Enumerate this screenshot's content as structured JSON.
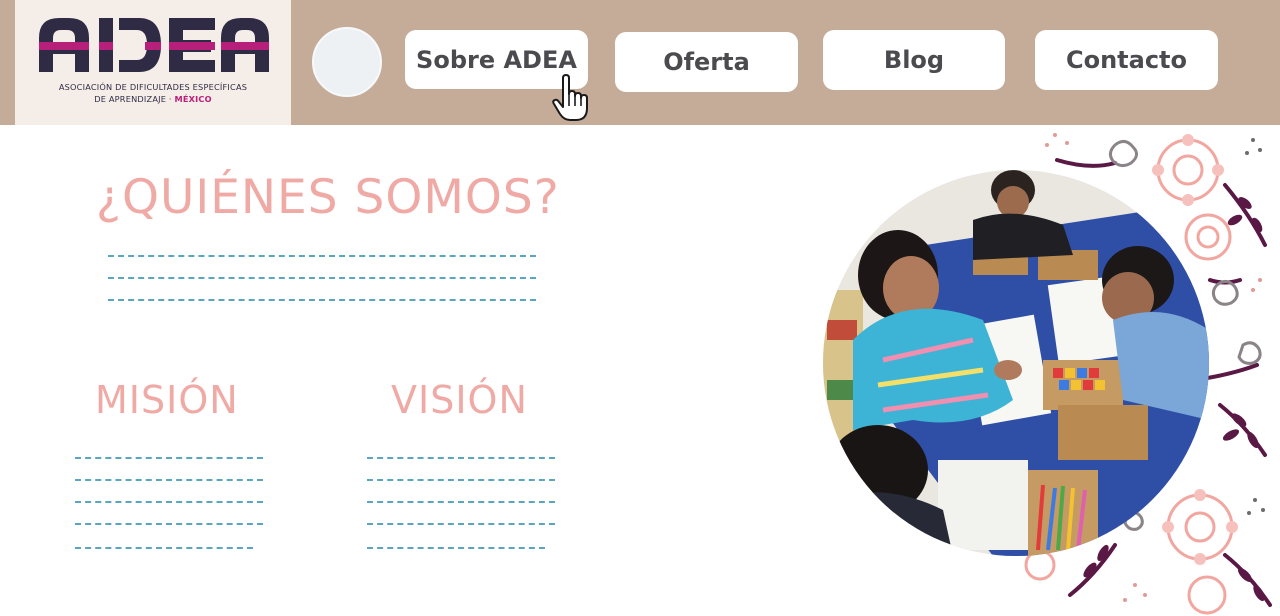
{
  "logo": {
    "wordmark": "ADEA",
    "caption_line1": "ASOCIACIÓN DE DIFICULTADES ESPECÍFICAS",
    "caption_line2": "DE APRENDIZAJE ·",
    "caption_country": "MÉXICO"
  },
  "nav": {
    "items": [
      {
        "label": "Sobre ADEA"
      },
      {
        "label": "Oferta"
      },
      {
        "label": "Blog"
      },
      {
        "label": "Contacto"
      }
    ]
  },
  "main": {
    "about_title": "¿QUIÉNES SOMOS?",
    "mission_title": "MISIÓN",
    "vision_title": "VISIÓN"
  },
  "colors": {
    "header_bg": "#c5ac98",
    "title_pink": "#f0aaa6",
    "placeholder_line": "#5aa6bf",
    "brand_dark": "#2f2b45",
    "brand_magenta": "#b7207a"
  },
  "icons": {
    "cursor": "hand-pointer-icon",
    "avatar": "avatar-circle"
  }
}
